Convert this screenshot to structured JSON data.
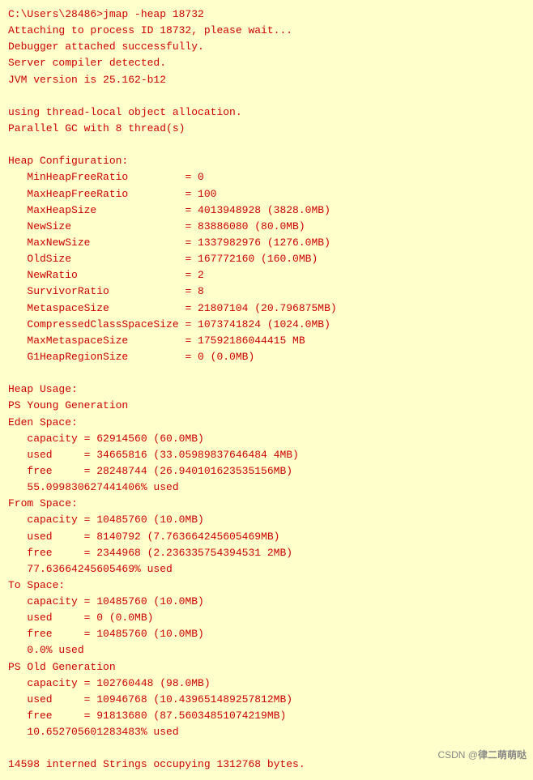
{
  "terminal": {
    "lines": [
      "C:\\Users\\28486>jmap -heap 18732",
      "Attaching to process ID 18732, please wait...",
      "Debugger attached successfully.",
      "Server compiler detected.",
      "JVM version is 25.162-b12",
      "",
      "using thread-local object allocation.",
      "Parallel GC with 8 thread(s)",
      "",
      "Heap Configuration:",
      "   MinHeapFreeRatio         = 0",
      "   MaxHeapFreeRatio         = 100",
      "   MaxHeapSize              = 4013948928 (3828.0MB)",
      "   NewSize                  = 83886080 (80.0MB)",
      "   MaxNewSize               = 1337982976 (1276.0MB)",
      "   OldSize                  = 167772160 (160.0MB)",
      "   NewRatio                 = 2",
      "   SurvivorRatio            = 8",
      "   MetaspaceSize            = 21807104 (20.796875MB)",
      "   CompressedClassSpaceSize = 1073741824 (1024.0MB)",
      "   MaxMetaspaceSize         = 17592186044415 MB",
      "   G1HeapRegionSize         = 0 (0.0MB)",
      "",
      "Heap Usage:",
      "PS Young Generation",
      "Eden Space:",
      "   capacity = 62914560 (60.0MB)",
      "   used     = 34665816 (33.05989837646484 4MB)",
      "   free     = 28248744 (26.940101623535156MB)",
      "   55.099830627441406% used",
      "From Space:",
      "   capacity = 10485760 (10.0MB)",
      "   used     = 8140792 (7.763664245605469MB)",
      "   free     = 2344968 (2.236335754394531 2MB)",
      "   77.63664245605469% used",
      "To Space:",
      "   capacity = 10485760 (10.0MB)",
      "   used     = 0 (0.0MB)",
      "   free     = 10485760 (10.0MB)",
      "   0.0% used",
      "PS Old Generation",
      "   capacity = 102760448 (98.0MB)",
      "   used     = 10946768 (10.439651489257812MB)",
      "   free     = 91813680 (87.56034851074219MB)",
      "   10.652705601283483% used",
      "",
      "14598 interned Strings occupying 1312768 bytes."
    ]
  },
  "watermark": {
    "prefix": "CSDN @",
    "username": "律二萌萌哒"
  }
}
